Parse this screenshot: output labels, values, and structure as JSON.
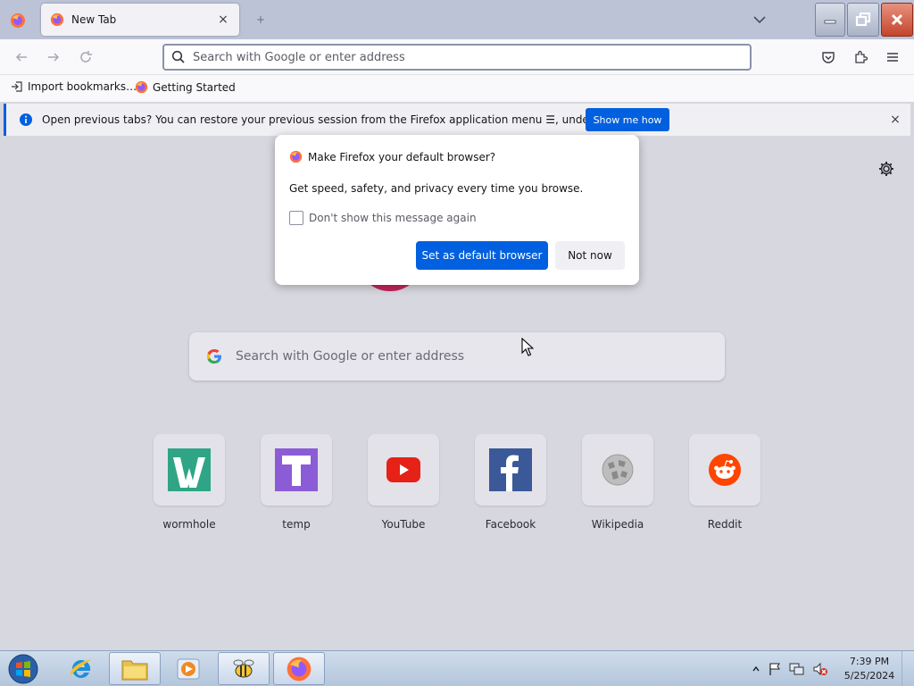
{
  "browser": {
    "tab": {
      "title": "New Tab",
      "close": "×"
    },
    "newtab_glyph": "+",
    "urlbar": {
      "placeholder": "Search with Google or enter address"
    }
  },
  "bookmarks": [
    {
      "label": "Import bookmarks…",
      "icon": "import-icon"
    },
    {
      "label": "Getting Started",
      "icon": "firefox-icon"
    }
  ],
  "notification": {
    "message": "Open previous tabs? You can restore your previous session from the Firefox application menu ☰, under History.",
    "button": "Show me how",
    "close": "×"
  },
  "content": {
    "search_placeholder": "Search with Google or enter address",
    "shortcuts": [
      {
        "name": "wormhole",
        "icon": "wormhole-icon",
        "color": "#2fa586"
      },
      {
        "name": "temp",
        "icon": "temp-icon",
        "color": "#8b5cd6"
      },
      {
        "name": "YouTube",
        "icon": "youtube-icon",
        "color": "#e62117"
      },
      {
        "name": "Facebook",
        "icon": "facebook-icon",
        "color": "#3b5998"
      },
      {
        "name": "Wikipedia",
        "icon": "wikipedia-icon",
        "color": "#9a9a9a"
      },
      {
        "name": "Reddit",
        "icon": "reddit-icon",
        "color": "#ff4500"
      }
    ]
  },
  "dialog": {
    "title": "Make Firefox your default browser?",
    "body": "Get speed, safety, and privacy every time you browse.",
    "checkbox_label": "Don't show this message again",
    "checkbox_checked": false,
    "primary_button": "Set as default browser",
    "secondary_button": "Not now"
  },
  "taskbar": {
    "clock_time": "7:39 PM",
    "clock_date": "5/25/2024"
  },
  "colors": {
    "accent": "#0060df",
    "close_button": "#c4452c"
  }
}
